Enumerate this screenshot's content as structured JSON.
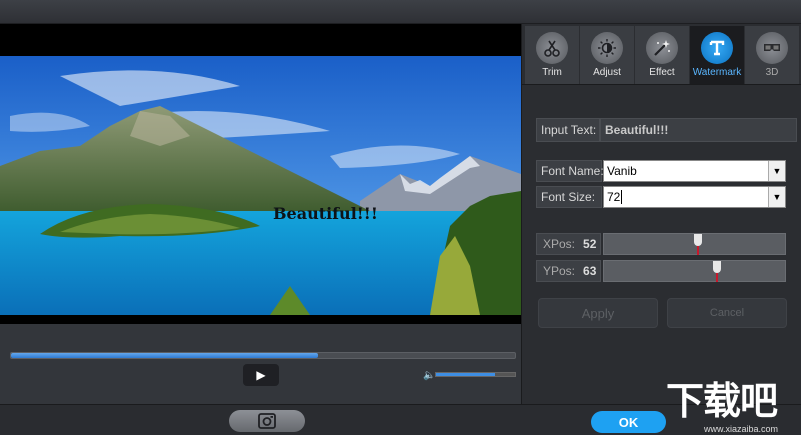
{
  "preview": {
    "watermark_text": "Beautiful!!!",
    "progress_percent": 61,
    "volume_percent": 75,
    "play_icon": "play-icon",
    "volume_icon": "speaker-icon"
  },
  "tabs": [
    {
      "label": "Trim",
      "icon": "scissors-icon"
    },
    {
      "label": "Adjust",
      "icon": "brightness-icon"
    },
    {
      "label": "Effect",
      "icon": "magic-wand-icon"
    },
    {
      "label": "Watermark",
      "icon": "text-icon",
      "active": true
    },
    {
      "label": "3D",
      "icon": "3d-glasses-icon"
    }
  ],
  "watermark": {
    "input_text_label": "Input Text:",
    "input_text_value": "Beautiful!!!",
    "font_name_label": "Font Name:",
    "font_name_value": "Vanib",
    "font_size_label": "Font Size:",
    "font_size_value": "72",
    "xpos_label": "XPos:",
    "xpos_value": "52",
    "xpos_fraction": 0.52,
    "ypos_label": "YPos:",
    "ypos_value": "63",
    "ypos_fraction": 0.63,
    "apply_label": "Apply",
    "cancel_label": "Cancel"
  },
  "bottom": {
    "snapshot_icon": "camera-icon",
    "ok_label": "OK"
  },
  "brand": {
    "logo_text": "下载吧",
    "url": "www.xiazaiba.com"
  },
  "colors": {
    "accent": "#1ea1f2",
    "active_tab_label": "#5ab6ff",
    "slider_marker": "#c8182c"
  }
}
